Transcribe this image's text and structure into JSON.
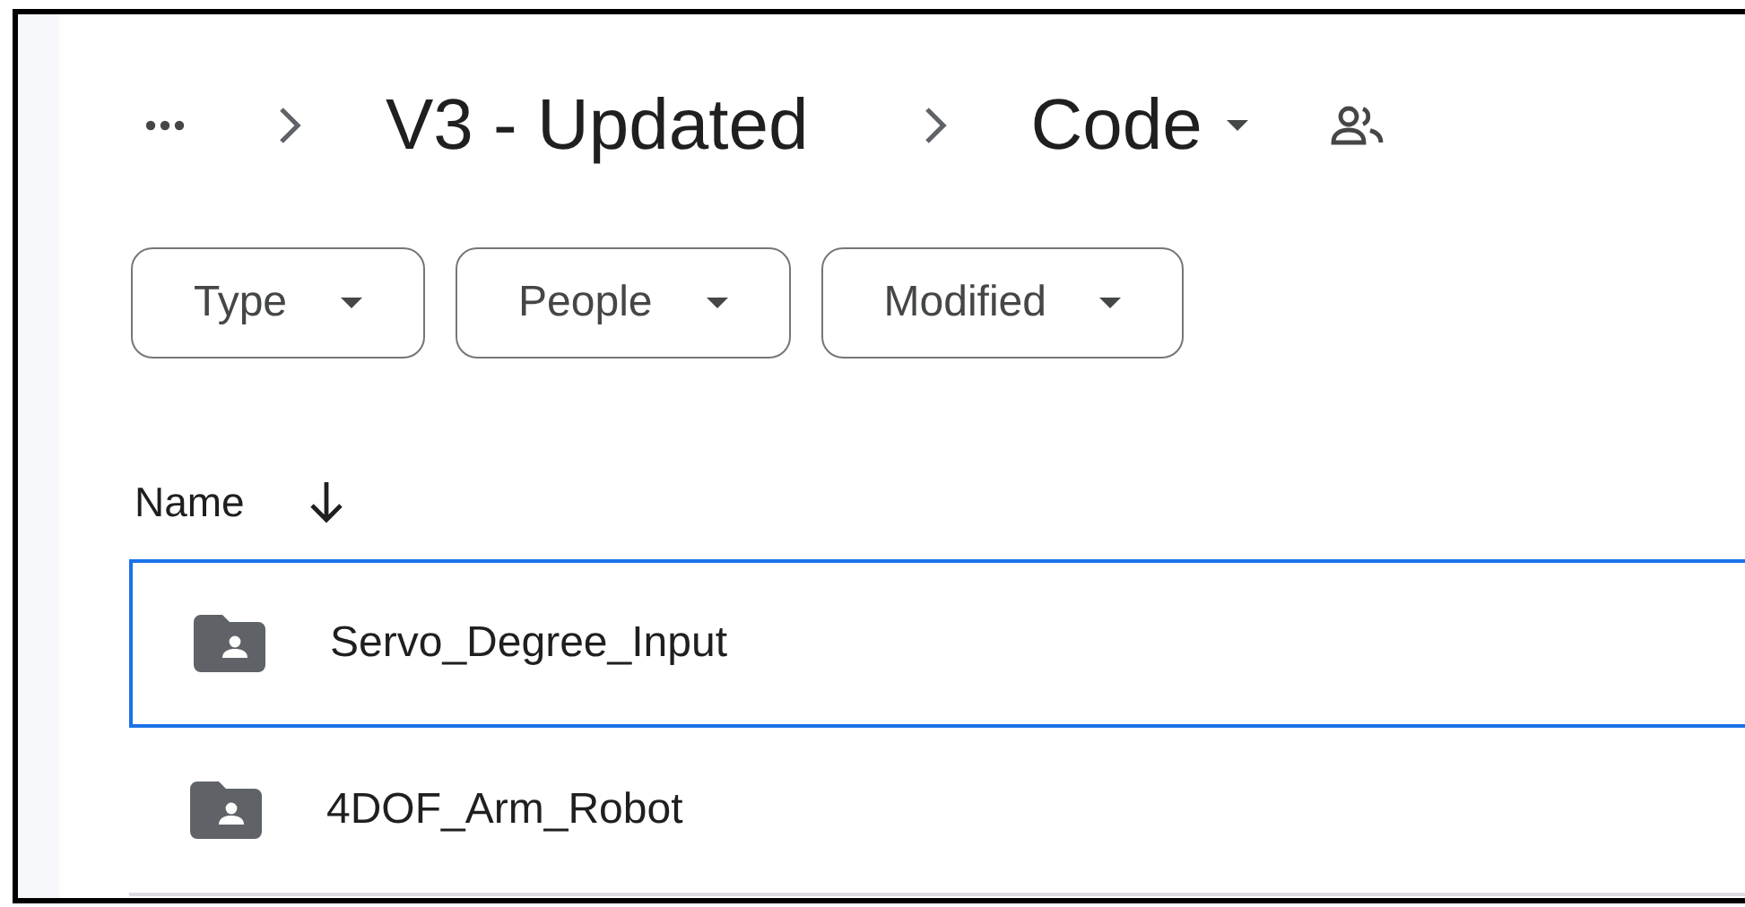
{
  "breadcrumb": {
    "items": [
      "V3 - Updated"
    ],
    "current": "Code"
  },
  "filters": [
    "Type",
    "People",
    "Modified"
  ],
  "list": {
    "header": "Name",
    "rows": [
      {
        "name": "Servo_Degree_Input",
        "selected": true
      },
      {
        "name": "4DOF_Arm_Robot",
        "selected": false
      }
    ]
  }
}
